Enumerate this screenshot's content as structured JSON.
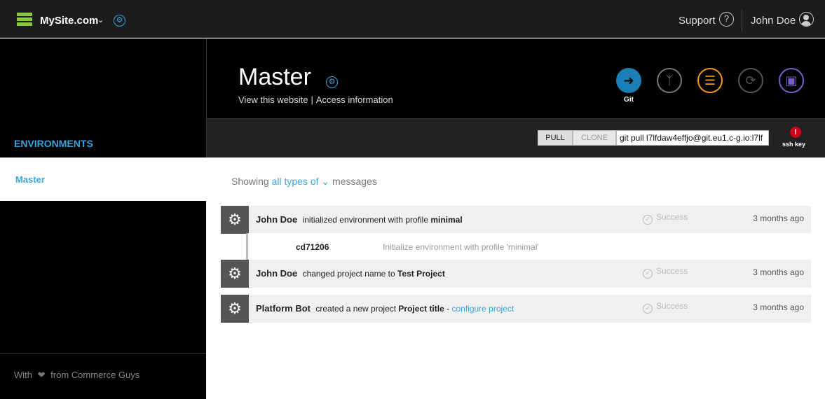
{
  "topbar": {
    "site_name": "MySite.com",
    "support_label": "Support",
    "user_name": "John Doe"
  },
  "sidebar": {
    "section_title": "ENVIRONMENTS",
    "items": [
      {
        "label": "Master"
      }
    ],
    "footer": {
      "prefix": "With",
      "suffix": "from Commerce Guys"
    }
  },
  "environment": {
    "title": "Master",
    "view_link": "View this website",
    "separator": "|",
    "access_link": "Access information",
    "actions": [
      {
        "name": "git",
        "label": "Git",
        "icon": "arrow-right-icon"
      },
      {
        "name": "branch",
        "icon": "branch-icon"
      },
      {
        "name": "merge",
        "icon": "layers-icon"
      },
      {
        "name": "sync",
        "icon": "sync-icon"
      },
      {
        "name": "backup",
        "icon": "save-icon"
      }
    ]
  },
  "git_bar": {
    "pull_label": "PULL",
    "clone_label": "CLONE",
    "command": "git pull l7lfdaw4effjo@git.eu1.c-g.io:l7lf",
    "ssh_label": "ssh key"
  },
  "messages": {
    "showing_prefix": "Showing",
    "filter_label": "all types of",
    "showing_suffix": "messages"
  },
  "activities": [
    {
      "who": "John Doe",
      "text": "initialized environment with profile",
      "target": "minimal",
      "status": "Success",
      "time": "3 months ago"
    },
    {
      "who": "John Doe",
      "text": "changed project name to",
      "target": "Test Project",
      "status": "Success",
      "time": "3 months ago"
    },
    {
      "who": "Platform Bot",
      "text": "created a new project",
      "target": "Project title",
      "dash": "-",
      "link": "configure project",
      "status": "Success",
      "time": "3 months ago"
    }
  ],
  "commit": {
    "hash": "cd71206",
    "message": "Initialize environment with profile 'minimal'"
  },
  "colors": {
    "accent": "#3aa5dd",
    "logo": "#8cc63f",
    "git": "#1b7fb6",
    "merge": "#f39c12",
    "backup": "#7b5fc8",
    "alert": "#d0021b"
  }
}
